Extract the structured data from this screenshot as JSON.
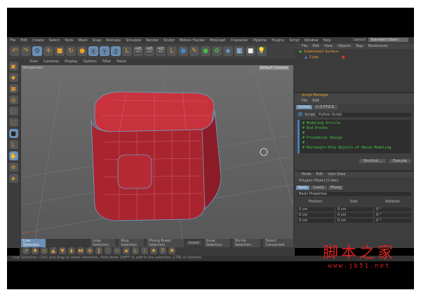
{
  "menu": [
    "File",
    "Edit",
    "Create",
    "Select",
    "Tools",
    "Mesh",
    "Snap",
    "Animate",
    "Simulate",
    "Render",
    "Sculpt",
    "Motion Tracker",
    "MoGraph",
    "Character",
    "Pipeline",
    "Plugins",
    "Script",
    "Window",
    "Help"
  ],
  "layout": {
    "label": "Layout:",
    "value": "Standard (User)"
  },
  "viewport": {
    "menu": [
      "View",
      "Cameras",
      "Display",
      "Options",
      "Filter",
      "Panel"
    ],
    "name": "Perspective",
    "camera": "Default Camera",
    "axis": "x y z"
  },
  "object_manager": {
    "menu": [
      "File",
      "Edit",
      "View",
      "Objects",
      "Tags",
      "Bookmarks"
    ],
    "objects": [
      "Subdivision Surface",
      "Cube"
    ]
  },
  "script_manager": {
    "title": "Script Manager",
    "menu": [
      "File",
      "Edit"
    ],
    "tabs": [
      "Python",
      "C.O.F.F.E.E."
    ],
    "script_label": "Script",
    "script_value": "Python Script",
    "code": [
      "# Modeling Article",
      "# Rod Brooks",
      "#",
      "# Procedural Design",
      "#",
      "# Rectangle Poly Objects of Dense Modeling"
    ],
    "buttons": [
      "Shortcut...",
      "Execute"
    ]
  },
  "attributes": {
    "menu": [
      "Mode",
      "Edit",
      "User Data"
    ],
    "object": "Polygon Object [Cube]",
    "tabs": [
      "Basic",
      "Coord.",
      "Phong"
    ],
    "section": "Basic Properties",
    "columns": [
      "Position",
      "Size",
      "Rotation"
    ],
    "rows": [
      [
        "0 cm",
        "0 cm",
        "0 °"
      ],
      [
        "0 cm",
        "0 cm",
        "0 °"
      ],
      [
        "0 cm",
        "0 cm",
        "0 °"
      ]
    ]
  },
  "selection_bar": [
    "Live Selection",
    "Loop Selection",
    "Ring Selection",
    "Phong Break Selection",
    "Invert",
    "Grow Selection",
    "Shrink Selection",
    "Select Connected"
  ],
  "status": "Live Selection: Click and drag to select elements. Hold down SHIFT to add to the selection, CTRL to remove.",
  "watermark": {
    "text": "脚本之家",
    "url": "www.jb51.net"
  }
}
